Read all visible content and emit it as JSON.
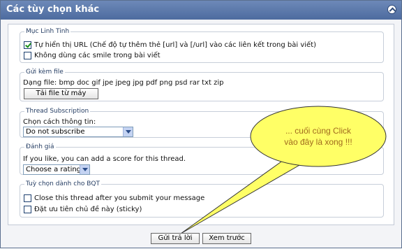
{
  "title": "Các tùy chọn khác",
  "misc": {
    "legend": "Mục Linh Tinh",
    "auto_url_label": "Tự hiển thị URL (Chế độ tự thêm thẻ [url] và [/url] vào các liên kết trong bài viết)",
    "auto_url_checked": true,
    "no_smilies_label": "Không dùng các smile trong bài viết",
    "no_smilies_checked": false
  },
  "attach": {
    "legend": "Gửi kèm file",
    "types_text": "Dạng file: bmp doc gif jpe jpeg jpg pdf png psd rar txt zip",
    "upload_button": "Tải file từ máy"
  },
  "subscription": {
    "legend": "Thread Subscription",
    "label": "Chọn cách thông tin:",
    "selected": "Do not subscribe"
  },
  "rating": {
    "legend": "Đánh giá",
    "prompt": "If you like, you can add a score for this thread.",
    "selected": "Choose a rating"
  },
  "mod": {
    "legend": "Tuỳ chọn dành cho BQT",
    "close_label": "Close this thread after you submit your message",
    "close_checked": false,
    "sticky_label": "Đặt ưu tiên chủ đề này (sticky)",
    "sticky_checked": false
  },
  "callout": {
    "line1": "... cuối cùng Click",
    "line2": "vào đây là xong !!!"
  },
  "buttons": {
    "submit": "Gửi trả lời",
    "preview": "Xem trước"
  }
}
